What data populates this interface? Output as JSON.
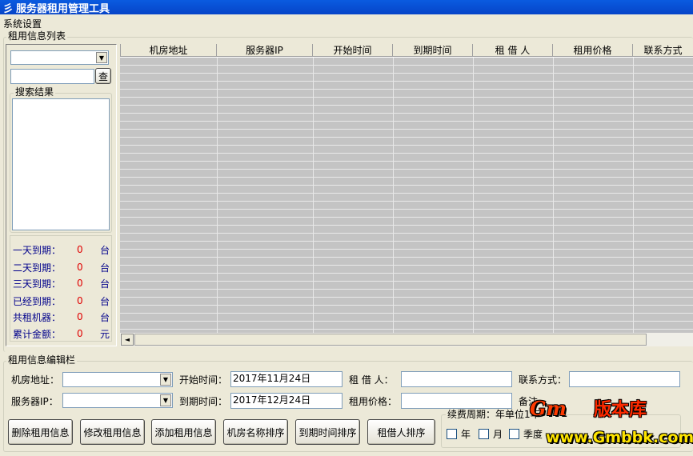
{
  "window": {
    "title": "服务器租用管理工具",
    "icon": "app-icon"
  },
  "menu": {
    "items": [
      "系统设置"
    ]
  },
  "list_group": {
    "title": "租用信息列表"
  },
  "search": {
    "button_label": "查",
    "results_title": "搜索结果",
    "query_value": "",
    "combo_value": ""
  },
  "stats": [
    {
      "label": "一天到期：",
      "value": "0",
      "unit": "台"
    },
    {
      "label": "二天到期：",
      "value": "0",
      "unit": "台"
    },
    {
      "label": "三天到期：",
      "value": "0",
      "unit": "台"
    },
    {
      "label": "已经到期：",
      "value": "0",
      "unit": "台"
    },
    {
      "label": "共租机器：",
      "value": "0",
      "unit": "台"
    },
    {
      "label": "累计金额：",
      "value": "0",
      "unit": "元"
    }
  ],
  "table": {
    "columns": [
      "机房地址",
      "服务器IP",
      "开始时间",
      "到期时间",
      "租 借 人",
      "租用价格",
      "联系方式"
    ]
  },
  "edit_group": {
    "title": "租用信息编辑栏",
    "fields": {
      "room_label": "机房地址：",
      "room_value": "",
      "ip_label": "服务器IP：",
      "ip_value": "",
      "start_label": "开始时间：",
      "start_value": "2017年11月24日",
      "end_label": "到期时间：",
      "end_value": "2017年12月24日",
      "renter_label": "租 借 人：",
      "renter_value": "",
      "price_label": "租用价格：",
      "price_value": "",
      "contact_label": "联系方式：",
      "contact_value": "",
      "note_label": "备注"
    },
    "buttons": [
      "删除租用信息",
      "修改租用信息",
      "添加租用信息",
      "机房名称排序",
      "到期时间排序",
      "租借人排序"
    ],
    "period": {
      "title": "续费周期：年单位1年",
      "options": [
        "年",
        "月",
        "季度"
      ]
    }
  },
  "watermark": {
    "logo": "Gm",
    "brand": "版本库",
    "url": "www.Gmbbk.com"
  }
}
